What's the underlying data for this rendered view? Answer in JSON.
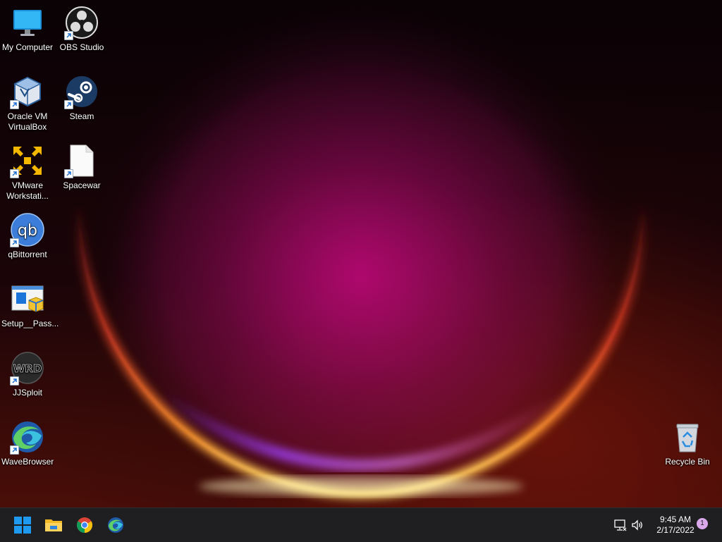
{
  "desktop_icons": [
    {
      "name": "My Computer",
      "icon": "monitor-icon",
      "shortcut": false
    },
    {
      "name": "OBS Studio",
      "icon": "obs-icon",
      "shortcut": true
    },
    {
      "name": "Oracle VM VirtualBox",
      "icon": "virtualbox-icon",
      "shortcut": true
    },
    {
      "name": "Steam",
      "icon": "steam-icon",
      "shortcut": true
    },
    {
      "name": "VMware Workstati...",
      "icon": "vmware-icon",
      "shortcut": true
    },
    {
      "name": "Spacewar",
      "icon": "file-icon",
      "shortcut": true
    },
    {
      "name": "qBittorrent",
      "icon": "qbittorrent-icon",
      "shortcut": true
    },
    {
      "name": "Setup__Pass...",
      "icon": "installer-icon",
      "shortcut": false
    },
    {
      "name": "JJSploit",
      "icon": "jjsploit-icon",
      "shortcut": true
    },
    {
      "name": "WaveBrowser",
      "icon": "wavebrowser-icon",
      "shortcut": true
    },
    {
      "name": "Recycle Bin",
      "icon": "recycle-bin-icon",
      "shortcut": false
    }
  ],
  "taskbar": {
    "pinned": [
      "start-button",
      "file-explorer-icon",
      "chrome-icon",
      "wavebrowser-icon"
    ],
    "tray": [
      "network-icon",
      "volume-icon"
    ],
    "clock": {
      "time": "9:45 AM",
      "date": "2/17/2022"
    },
    "notification_count": "1"
  },
  "colors": {
    "taskbar_bg": "#1f1f22",
    "start_blue": "#1e9bf0",
    "wallpaper_accent": "#c0087a"
  }
}
